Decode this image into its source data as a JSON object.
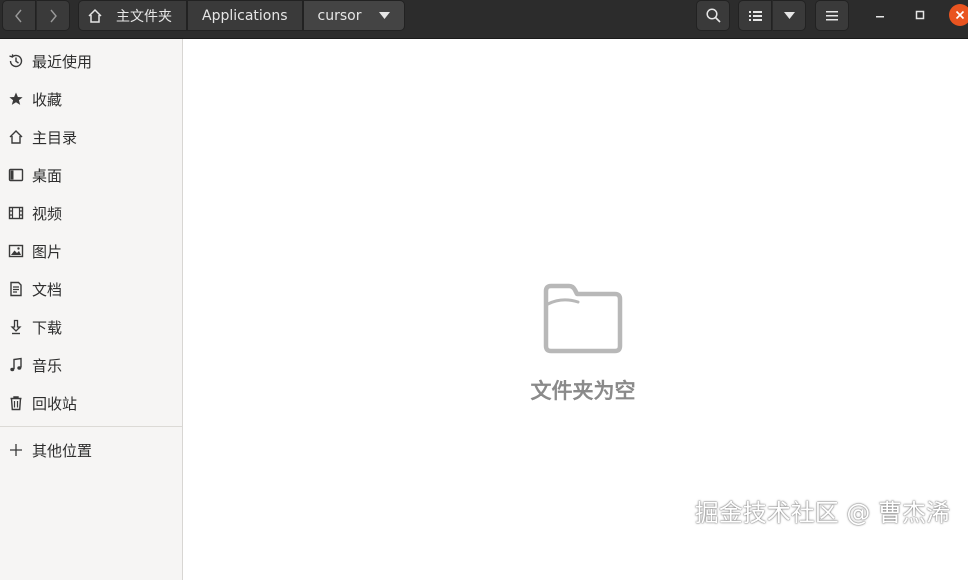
{
  "header": {
    "breadcrumbs": [
      "主文件夹",
      "Applications",
      "cursor"
    ]
  },
  "sidebar": {
    "items": [
      {
        "label": "最近使用",
        "icon": "clock-icon"
      },
      {
        "label": "收藏",
        "icon": "star-icon"
      },
      {
        "label": "主目录",
        "icon": "home-icon"
      },
      {
        "label": "桌面",
        "icon": "desktop-icon"
      },
      {
        "label": "视频",
        "icon": "film-icon"
      },
      {
        "label": "图片",
        "icon": "image-icon"
      },
      {
        "label": "文档",
        "icon": "document-icon"
      },
      {
        "label": "下载",
        "icon": "download-icon"
      },
      {
        "label": "音乐",
        "icon": "music-icon"
      },
      {
        "label": "回收站",
        "icon": "trash-icon"
      }
    ],
    "other_locations": {
      "label": "其他位置",
      "icon": "plus-icon"
    }
  },
  "main": {
    "empty_message": "文件夹为空",
    "empty_icon": "folder-icon"
  },
  "watermark": "掘金技术社区 @ 曹杰浠",
  "colors": {
    "headerbar": "#2c2c2c",
    "sidebar": "#f6f5f4",
    "close_button": "#e95420",
    "empty_text": "#8a8a8a"
  }
}
